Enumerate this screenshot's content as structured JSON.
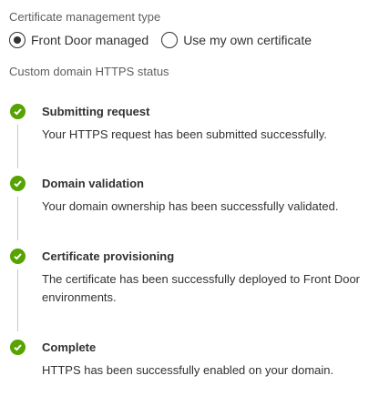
{
  "certificate": {
    "label": "Certificate management type",
    "options": [
      {
        "label": "Front Door managed",
        "selected": true
      },
      {
        "label": "Use my own certificate",
        "selected": false
      }
    ]
  },
  "status": {
    "label": "Custom domain HTTPS status",
    "success_color": "#57a300",
    "steps": [
      {
        "title": "Submitting request",
        "description": "Your HTTPS request has been submitted successfully.",
        "icon": "check-circle-icon"
      },
      {
        "title": "Domain validation",
        "description": "Your domain ownership has been successfully validated.",
        "icon": "check-circle-icon"
      },
      {
        "title": "Certificate provisioning",
        "description": "The certificate has been successfully deployed to Front Door environments.",
        "icon": "check-circle-icon"
      },
      {
        "title": "Complete",
        "description": "HTTPS has been successfully enabled on your domain.",
        "icon": "check-circle-icon"
      }
    ]
  }
}
